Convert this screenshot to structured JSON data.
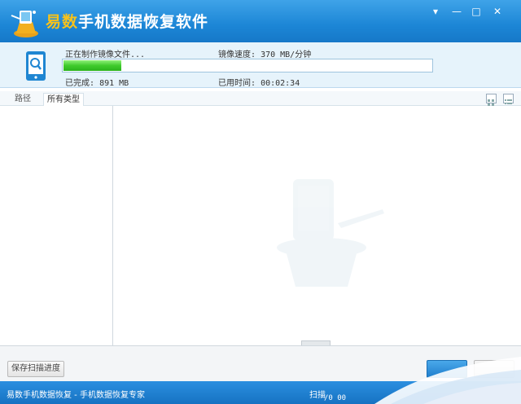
{
  "window": {
    "title_prefix": "易数",
    "title_rest": "手机数据恢复软件",
    "controls": {
      "menu": "▾",
      "minimize": "—",
      "maximize": "□",
      "close": "✕"
    }
  },
  "progress": {
    "status_label": "正在制作镜像文件...",
    "speed_label": "镜像速度:",
    "speed_value": "370 MB/分钟",
    "done_label": "已完成:",
    "done_value": "891 MB",
    "elapsed_label": "已用时间:",
    "elapsed_value": "00:02:34",
    "fraction": 0.16,
    "fill_color": "#3fcb2c"
  },
  "tabs": [
    {
      "label": "路径",
      "active": false
    },
    {
      "label": "所有类型",
      "active": true
    }
  ],
  "view_icons": [
    "grid-view-icon",
    "list-view-icon"
  ],
  "buttons": {
    "save_progress": "保存扫描进度"
  },
  "status_bar": {
    "text": "易数手机数据恢复 - 手机数据恢复专家",
    "right_text": "扫描",
    "time_text": "/0 00"
  },
  "colors": {
    "titlebar": "#1c86d6",
    "title_accent": "#f7c21b",
    "panel_bg": "#e6f3fb",
    "statusbar": "#1672c2"
  }
}
